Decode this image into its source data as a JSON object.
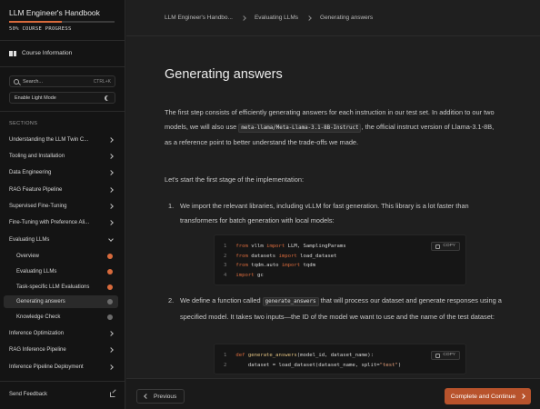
{
  "sidebar": {
    "title": "LLM Engineer's Handbook",
    "progress": {
      "fraction": 0.5,
      "label": "50% COURSE PROGRESS"
    },
    "course_info": "Course Information",
    "search": {
      "placeholder": "Search...",
      "shortcut": "CTRL+K"
    },
    "light_mode": "Enable Light Mode",
    "sections_label": "SECTIONS",
    "items": [
      {
        "label": "Understanding the LLM Twin C...",
        "marker": "chevron-right-icon"
      },
      {
        "label": "Tooling and Installation",
        "marker": "chevron-right-icon"
      },
      {
        "label": "Data Engineering",
        "marker": "chevron-right-icon"
      },
      {
        "label": "RAG Feature Pipeline",
        "marker": "chevron-right-icon"
      },
      {
        "label": "Supervised Fine-Tuning",
        "marker": "chevron-right-icon"
      },
      {
        "label": "Fine-Tuning with Preference Ali...",
        "marker": "chevron-right-icon"
      },
      {
        "label": "Evaluating LLMs",
        "marker": "chevron-down-icon"
      },
      {
        "label": "Overview",
        "status": "completed"
      },
      {
        "label": "Evaluating LLMs",
        "status": "completed"
      },
      {
        "label": "Task-specific LLM Evaluations",
        "status": "completed"
      },
      {
        "label": "Generating answers",
        "status": "current"
      },
      {
        "label": "Knowledge Check",
        "status": "not-started"
      },
      {
        "label": "Inference Optimization",
        "marker": "chevron-right-icon"
      },
      {
        "label": "RAG Inference Pipeline",
        "marker": "chevron-right-icon"
      },
      {
        "label": "Inference Pipeline Deployment",
        "marker": "chevron-right-icon"
      }
    ],
    "feedback": "Send Feedback"
  },
  "breadcrumb": [
    "LLM Engineer's Handbo...",
    "Evaluating LLMs",
    "Generating answers"
  ],
  "page": {
    "title": "Generating answers",
    "intro_1": "The first step consists of efficiently generating answers for each instruction in our test set. In addition to our two models, we will also use",
    "intro_code": "meta-llama/Meta-Llama-3.1-8B-Instruct",
    "intro_2": ", the official instruct version of Llama-3.1-8B, as a reference point to better understand the trade-offs we made.",
    "lead": "Let's start the first stage of the implementation:",
    "steps": [
      {
        "num": "1.",
        "text": "We import the relevant libraries, including vLLM for fast generation. This library is a lot faster than transformers for batch generation with local models:"
      },
      {
        "num": "2.",
        "text_a": "We define a function called",
        "code": "generate_answers",
        "text_b": "that will process our dataset and generate responses using a specified model. It takes two inputs—the ID of the model we want to use and the name of the test dataset:"
      }
    ],
    "copy_label": "COPY",
    "code_block_1": [
      {
        "n": "1",
        "a": "from",
        "b": " vllm ",
        "c": "import",
        "d": " LLM, SamplingParams"
      },
      {
        "n": "2",
        "a": "from",
        "b": " datasets ",
        "c": "import",
        "d": " load_dataset"
      },
      {
        "n": "3",
        "a": "from",
        "b": " tqdm.auto ",
        "c": "import",
        "d": " tqdm"
      },
      {
        "n": "4",
        "a": "import",
        "b": " gc",
        "c": "",
        "d": ""
      }
    ],
    "code_block_2": {
      "line1": {
        "n": "1",
        "kw": "def",
        "fn": " generate_answers",
        "rest": "(model_id, dataset_name):"
      },
      "line2": {
        "n": "2",
        "pre": "    dataset = load_dataset(dataset_name, split=",
        "str": "\"test\"",
        "post": ")"
      }
    }
  },
  "footer": {
    "previous": "Previous",
    "next": "Complete and Continue"
  },
  "colors": {
    "accent": "#d86a3c",
    "button": "#b8532c"
  }
}
